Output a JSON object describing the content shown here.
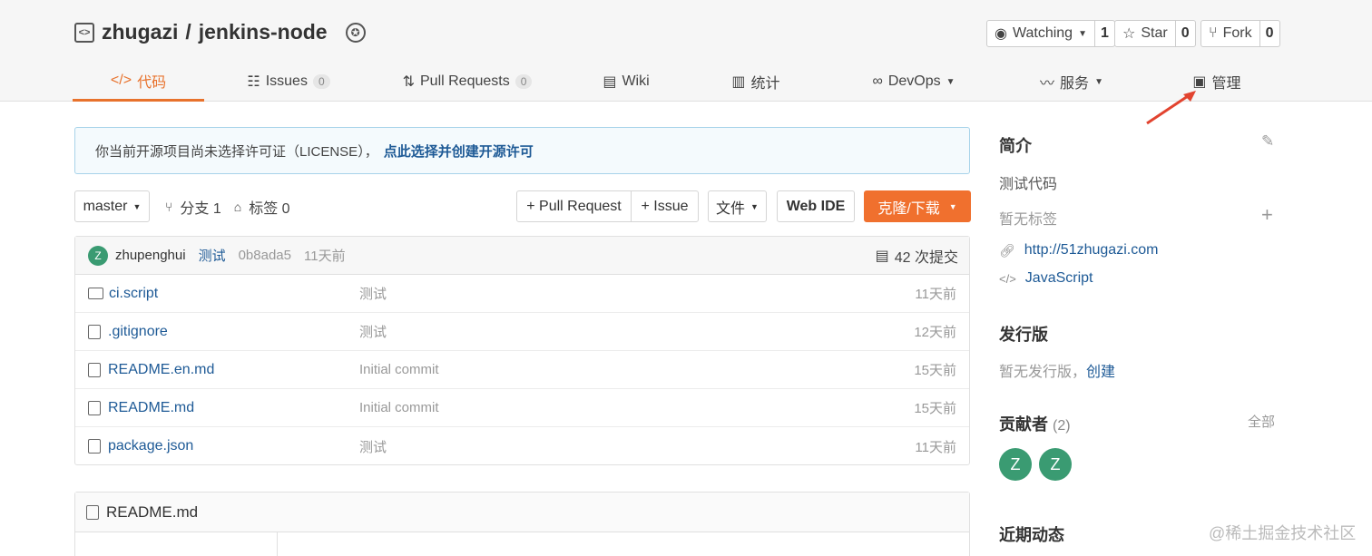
{
  "repo": {
    "owner": "zhugazi",
    "name": "jenkins-node",
    "separator": "/"
  },
  "actions": {
    "watching_label": "Watching",
    "watching_count": "1",
    "star_label": "Star",
    "star_count": "0",
    "fork_label": "Fork",
    "fork_count": "0"
  },
  "nav": {
    "code": "代码",
    "issues": "Issues",
    "issues_count": "0",
    "pull_requests": "Pull Requests",
    "pull_requests_count": "0",
    "wiki": "Wiki",
    "stats": "统计",
    "devops": "DevOps",
    "services": "服务",
    "manage": "管理"
  },
  "license": {
    "text": "你当前开源项目尚未选择许可证（LICENSE），",
    "link": "点此选择并创建开源许可"
  },
  "toolbar": {
    "branch": "master",
    "branches": "分支 1",
    "tags": "标签 0",
    "pull_request": "+ Pull Request",
    "issue": "+ Issue",
    "files": "文件",
    "web_ide": "Web IDE",
    "clone": "克隆/下载"
  },
  "commit": {
    "author_initial": "Z",
    "author": "zhupenghui",
    "message": "测试",
    "hash": "0b8ada5",
    "time": "11天前",
    "count": "42 次提交"
  },
  "files": [
    {
      "name": "ci.script",
      "type": "folder",
      "message": "测试",
      "time": "11天前"
    },
    {
      "name": ".gitignore",
      "type": "file",
      "message": "测试",
      "time": "12天前"
    },
    {
      "name": "README.en.md",
      "type": "file",
      "message": "Initial commit",
      "time": "15天前"
    },
    {
      "name": "README.md",
      "type": "file",
      "message": "Initial commit",
      "time": "15天前"
    },
    {
      "name": "package.json",
      "type": "file",
      "message": "测试",
      "time": "11天前"
    }
  ],
  "readme": {
    "title": "README.md"
  },
  "sidebar": {
    "intro_title": "简介",
    "intro_text": "测试代码",
    "no_tags": "暂无标签",
    "website": "http://51zhugazi.com",
    "language": "JavaScript",
    "release_title": "发行版",
    "no_release": "暂无发行版，",
    "create": "创建",
    "contributors_title": "贡献者",
    "contributors_count": "(2)",
    "all": "全部",
    "contributor_1": "Z",
    "contributor_2": "Z",
    "activity_title": "近期动态"
  },
  "watermark": "@稀土掘金技术社区",
  "colors": {
    "accent": "#e8722c",
    "link": "#1e5a96",
    "avatar": "#3a9b72",
    "arrow": "#e2432f"
  }
}
